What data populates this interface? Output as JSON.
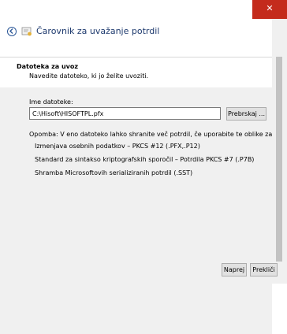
{
  "window": {
    "title": "Čarovnik za uvažanje potrdil",
    "close_glyph": "✕"
  },
  "section": {
    "title": "Datoteka za uvoz",
    "description": "Navedite datoteko, ki jo želite uvoziti."
  },
  "file": {
    "label": "Ime datoteke:",
    "value": "C:\\Hisoft\\HISOFTPL.pfx",
    "browse_label": "Prebrskaj ..."
  },
  "note": "Opomba: V eno datoteko lahko shranite več potrdil, če uporabite te oblike zapisov:",
  "formats": [
    "Izmenjava osebnih podatkov – PKCS #12 (.PFX,.P12)",
    "Standard za sintakso kriptografskih sporočil – Potrdila PKCS #7 (.P7B)",
    "Shramba Microsoftovih serializiranih potrdil (.SST)"
  ],
  "buttons": {
    "next": "Naprej",
    "cancel": "Prekliči"
  },
  "icons": {
    "back": "back-arrow-icon",
    "wizard": "certificate-icon",
    "close": "close-icon"
  },
  "colors": {
    "close": "#c42b1c",
    "title": "#1e3a6e",
    "panel": "#f0f0f0"
  }
}
